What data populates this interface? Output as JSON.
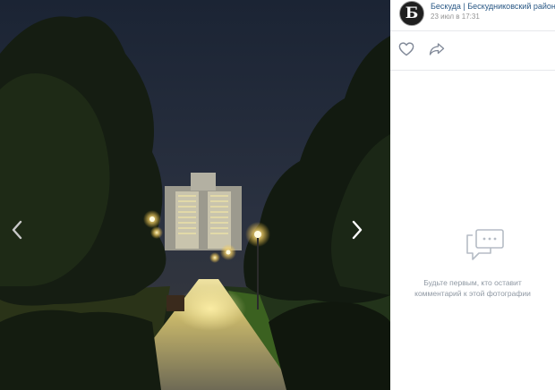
{
  "post": {
    "author": "Бескуда | Бескудниковский район",
    "date": "23 июл в 17:31",
    "avatar_letter": "Б"
  },
  "actions": {
    "like_icon": "heart-icon",
    "share_icon": "share-arrow-icon"
  },
  "comments": {
    "empty_text_line1": "Будьте первым, кто оставит",
    "empty_text_line2": "комментарий к этой фотографии",
    "icon": "speech-bubble-icon"
  },
  "navigation": {
    "prev_icon": "chevron-left-icon",
    "next_icon": "chevron-right-icon"
  },
  "colors": {
    "link": "#2a5885",
    "muted": "#939393",
    "icon": "#828a99",
    "empty_text": "#8f98a3"
  }
}
